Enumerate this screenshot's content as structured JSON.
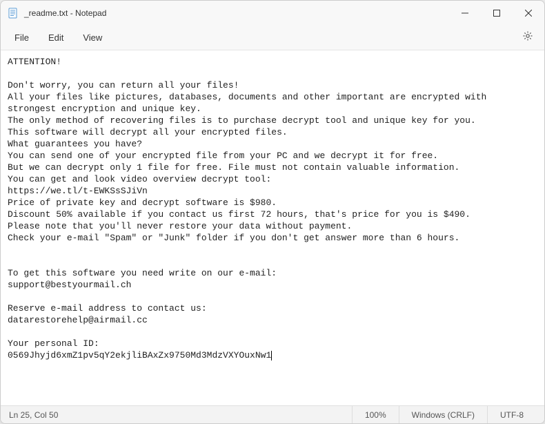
{
  "window": {
    "title": "_readme.txt - Notepad"
  },
  "menubar": {
    "file": "File",
    "edit": "Edit",
    "view": "View"
  },
  "document": {
    "l0": "ATTENTION!",
    "l1": "",
    "l2": "Don't worry, you can return all your files!",
    "l3": "All your files like pictures, databases, documents and other important are encrypted with strongest encryption and unique key.",
    "l4": "The only method of recovering files is to purchase decrypt tool and unique key for you.",
    "l5": "This software will decrypt all your encrypted files.",
    "l6": "What guarantees you have?",
    "l7": "You can send one of your encrypted file from your PC and we decrypt it for free.",
    "l8": "But we can decrypt only 1 file for free. File must not contain valuable information.",
    "l9": "You can get and look video overview decrypt tool:",
    "l10": "https://we.tl/t-EWKSsSJiVn",
    "l11": "Price of private key and decrypt software is $980.",
    "l12": "Discount 50% available if you contact us first 72 hours, that's price for you is $490.",
    "l13": "Please note that you'll never restore your data without payment.",
    "l14": "Check your e-mail \"Spam\" or \"Junk\" folder if you don't get answer more than 6 hours.",
    "l15": "",
    "l16": "",
    "l17": "To get this software you need write on our e-mail:",
    "l18": "support@bestyourmail.ch",
    "l19": "",
    "l20": "Reserve e-mail address to contact us:",
    "l21": "datarestorehelp@airmail.cc",
    "l22": "",
    "l23": "Your personal ID:",
    "l24": "0569Jhyjd6xmZ1pv5qY2ekjliBAxZx9750Md3MdzVXYOuxNw1"
  },
  "statusbar": {
    "position": "Ln 25, Col 50",
    "zoom": "100%",
    "lineending": "Windows (CRLF)",
    "encoding": "UTF-8"
  }
}
